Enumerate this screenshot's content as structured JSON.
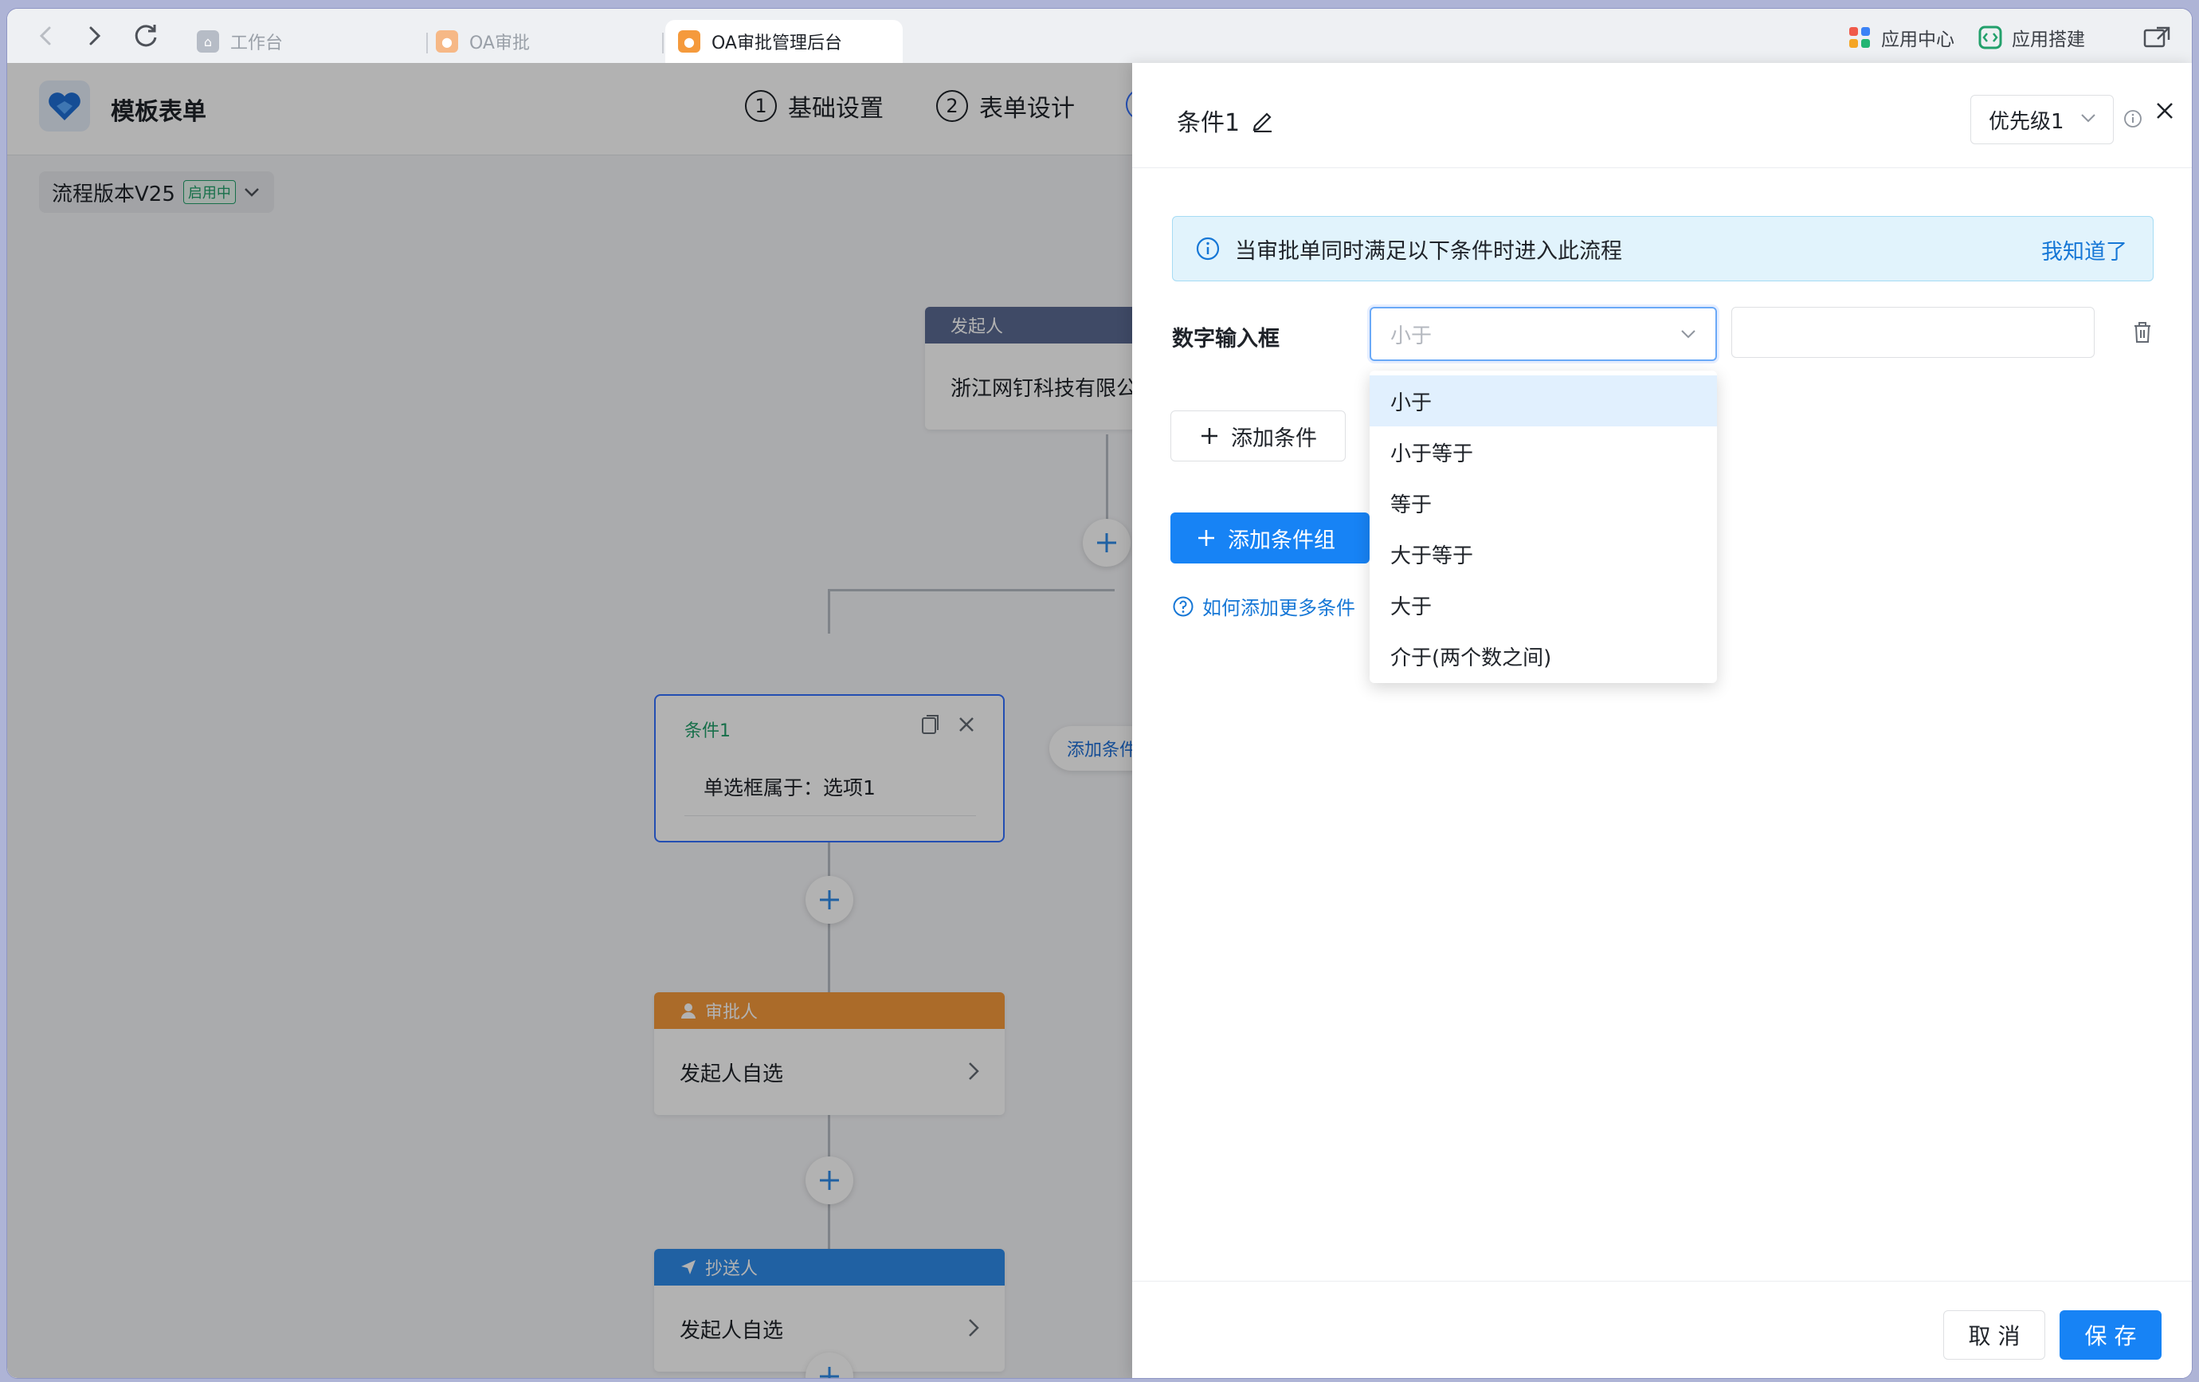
{
  "browser": {
    "tabs": [
      {
        "label": "工作台",
        "icon": "org-chart-icon"
      },
      {
        "label": "OA审批",
        "icon": "person-icon"
      },
      {
        "label": "OA审批管理后台",
        "icon": "person-icon"
      }
    ],
    "right_items": [
      {
        "label": "应用中心",
        "icon": "grid-apps-icon"
      },
      {
        "label": "应用搭建",
        "icon": "code-box-icon"
      }
    ]
  },
  "app": {
    "title": "模板表单",
    "steps": [
      {
        "num": "1",
        "label": "基础设置"
      },
      {
        "num": "2",
        "label": "表单设计"
      }
    ],
    "version": {
      "label": "流程版本V25",
      "status": "启用中"
    }
  },
  "flow": {
    "initiator": {
      "head": "发起人",
      "body": "浙江网钉科技有限公"
    },
    "add_condition_label": "添加条件",
    "condition": {
      "title": "条件1",
      "body": "单选框属于：选项1"
    },
    "approver": {
      "head": "审批人",
      "body": "发起人自选"
    },
    "cc": {
      "head": "抄送人",
      "body": "发起人自选"
    }
  },
  "drawer": {
    "title": "条件1",
    "priority": "优先级1",
    "banner_text": "当审批单同时满足以下条件时进入此流程",
    "banner_action": "我知道了",
    "field_label": "数字输入框",
    "select_placeholder": "小于",
    "options": [
      "小于",
      "小于等于",
      "等于",
      "大于等于",
      "大于",
      "介于(两个数之间)"
    ],
    "add_condition": "添加条件",
    "add_condition_group": "添加条件组",
    "help_link": "如何添加更多条件",
    "cancel": "取 消",
    "save": "保 存"
  },
  "colors": {
    "primary": "#1783f5",
    "initiator_head": "#5b6a92",
    "approver_head": "#f59a3c",
    "cc_head": "#2e8bea",
    "condition_green": "#22a06b"
  }
}
